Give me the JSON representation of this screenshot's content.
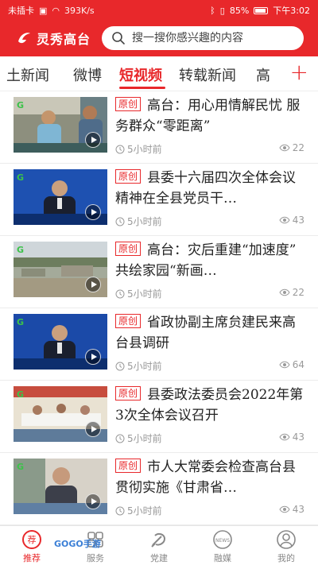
{
  "status_bar": {
    "carrier": "未插卡",
    "speed": "393K/s",
    "battery": "85%",
    "time": "下午3:02"
  },
  "header": {
    "app_name": "灵秀高台",
    "search_placeholder": "搜一搜你感兴趣的内容"
  },
  "tabs": [
    {
      "label": "土新闻"
    },
    {
      "label": "微博"
    },
    {
      "label": "短视频",
      "active": true
    },
    {
      "label": "转载新闻"
    },
    {
      "label": "高"
    }
  ],
  "tab_add_label": "+",
  "news": [
    {
      "badge": "原创",
      "title": "高台：用心用情解民忧 服务群众“零距离”",
      "time": "5小时前",
      "views": "22"
    },
    {
      "badge": "原创",
      "title": "县委十六届四次全体会议精神在全县党员干…",
      "time": "5小时前",
      "views": "43"
    },
    {
      "badge": "原创",
      "title": "高台：灾后重建“加速度” 共绘家园“新画…",
      "time": "5小时前",
      "views": "22"
    },
    {
      "badge": "原创",
      "title": "省政协副主席贠建民来高台县调研",
      "time": "5小时前",
      "views": "64"
    },
    {
      "badge": "原创",
      "title": "县委政法委员会2022年第3次全体会议召开",
      "time": "5小时前",
      "views": "43"
    },
    {
      "badge": "原创",
      "title": "市人大常委会检查高台县贯彻实施《甘肃省…",
      "time": "5小时前",
      "views": "43"
    }
  ],
  "bottom_nav": [
    {
      "label": "推荐",
      "active": true
    },
    {
      "label": "服务"
    },
    {
      "label": "党建"
    },
    {
      "label": "融媒"
    },
    {
      "label": "我的"
    }
  ],
  "watermark": "GOGO手游",
  "colors": {
    "brand_red": "#e8282b",
    "meta_gray": "#999999"
  }
}
